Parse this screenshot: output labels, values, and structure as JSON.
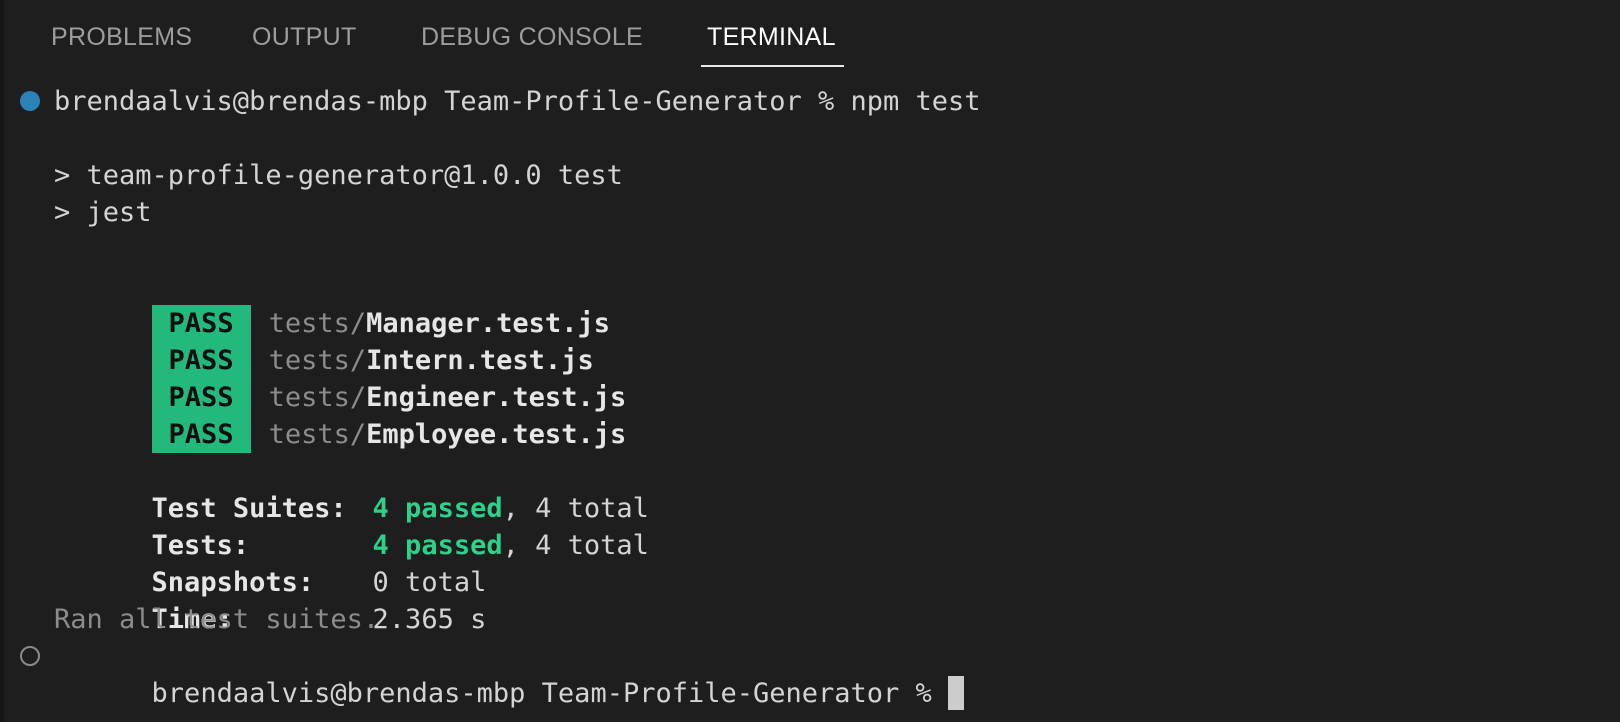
{
  "tabs": [
    {
      "label": "PROBLEMS",
      "active": false
    },
    {
      "label": "OUTPUT",
      "active": false
    },
    {
      "label": "DEBUG CONSOLE",
      "active": false
    },
    {
      "label": "TERMINAL",
      "active": true
    }
  ],
  "terminal": {
    "prompt_1": "brendaalvis@brendas-mbp Team-Profile-Generator % npm test",
    "script_line": "> team-profile-generator@1.0.0 test",
    "jest_line": "> jest",
    "results": [
      {
        "status": "PASS",
        "dir": "tests/",
        "file": "Manager.test.js"
      },
      {
        "status": "PASS",
        "dir": "tests/",
        "file": "Intern.test.js"
      },
      {
        "status": "PASS",
        "dir": "tests/",
        "file": "Engineer.test.js"
      },
      {
        "status": "PASS",
        "dir": "tests/",
        "file": "Employee.test.js"
      }
    ],
    "summary": {
      "suites_label": "Test Suites:",
      "suites_passed": "4 passed",
      "suites_total": ", 4 total",
      "tests_label": "Tests:",
      "tests_passed": "4 passed",
      "tests_total": ", 4 total",
      "snapshots_label": "Snapshots:",
      "snapshots_value": "0 total",
      "time_label": "Time:",
      "time_value": "2.365 s"
    },
    "ran_all": "Ran all test suites.",
    "prompt_2": "brendaalvis@brendas-mbp Team-Profile-Generator % "
  },
  "colors": {
    "background": "#1e1e1e",
    "pass_badge": "#23b97c",
    "passed_text": "#2ed18a",
    "prompt_dot_success": "#2b82b8"
  }
}
